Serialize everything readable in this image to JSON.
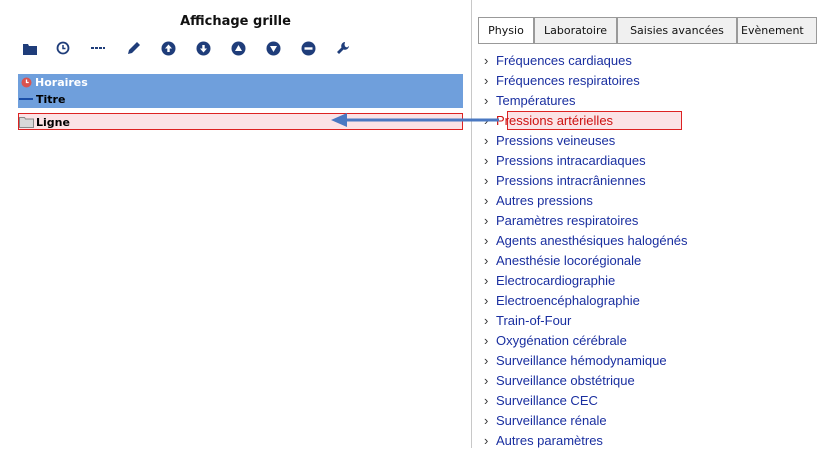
{
  "left_panel": {
    "title": "Affichage grille",
    "toolbar": [
      "folder-icon",
      "clock-icon",
      "dashes-icon",
      "pencil-icon",
      "arrow-up-circle-icon",
      "arrow-down-circle-icon",
      "triangle-up-circle-icon",
      "triangle-down-circle-icon",
      "minus-circle-icon",
      "wrench-icon"
    ],
    "rows": {
      "horaires": "Horaires",
      "titre": "Titre",
      "ligne": "Ligne"
    }
  },
  "right_panel": {
    "tabs": [
      "Physio",
      "Laboratoire",
      "Saisies avancées",
      "Evènement"
    ],
    "active_tab": "Physio",
    "items": [
      "Fréquences cardiaques",
      "Fréquences respiratoires",
      "Températures",
      "Pressions artérielles",
      "Pressions veineuses",
      "Pressions intracardiaques",
      "Pressions intracrâniennes",
      "Autres pressions",
      "Paramètres respiratoires",
      "Agents anesthésiques halogénés",
      "Anesthésie locorégionale",
      "Electrocardiographie",
      "Electroencéphalographie",
      "Train-of-Four",
      "Oxygénation cérébrale",
      "Surveillance hémodynamique",
      "Surveillance obstétrique",
      "Surveillance CEC",
      "Surveillance rénale",
      "Autres paramètres"
    ],
    "selected_item": "Pressions artérielles"
  },
  "colors": {
    "row_blue": "#6f9fdc",
    "highlight_border": "#dd2222",
    "highlight_fill": "#fbe3e6",
    "arrow": "#4a78c2",
    "list_text": "#1a2fa0"
  }
}
